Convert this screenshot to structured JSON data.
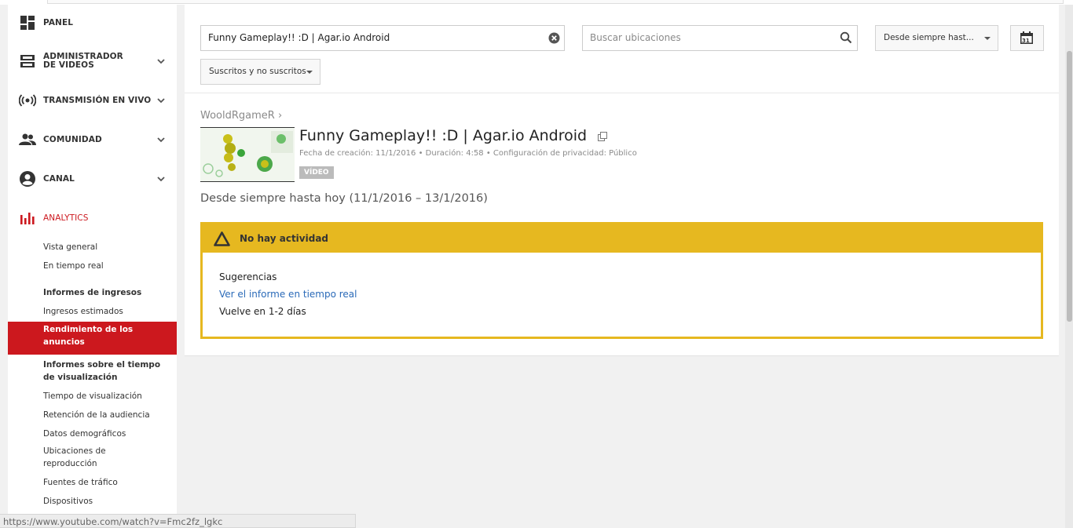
{
  "sidebar": {
    "main": [
      {
        "label": "PANEL"
      },
      {
        "label": "ADMINISTRADOR DE VIDEOS"
      },
      {
        "label": "TRANSMISIÓN EN VIVO"
      },
      {
        "label": "COMUNIDAD"
      },
      {
        "label": "CANAL"
      },
      {
        "label": "ANALYTICS"
      }
    ],
    "analytics_items": [
      "Vista general",
      "En tiempo real",
      "Informes de ingresos",
      "Ingresos estimados",
      "Rendimiento de los anuncios",
      "Informes sobre el tiempo de visualización",
      "Tiempo de visualización",
      "Retención de la audiencia",
      "Datos demográficos",
      "Ubicaciones de reproducción",
      "Fuentes de tráfico",
      "Dispositivos"
    ],
    "accent_color": "#cc181e"
  },
  "filters": {
    "search_value": "Funny Gameplay!! :D | Agar.io Android",
    "location_placeholder": "Buscar ubicaciones",
    "date_label": "Desde siempre hast...",
    "calendar_day": "31",
    "subscribers_label": "Suscritos y no suscritos"
  },
  "video": {
    "channel": "WooldRgameR",
    "channel_sep": "›",
    "title": "Funny Gameplay!! :D | Agar.io Android",
    "meta": "Fecha de creación: 11/1/2016  •  Duración: 4:58  •  Configuración de privacidad: Público",
    "badge": "VÍDEO"
  },
  "range_text": "Desde siempre hasta hoy (11/1/2016 – 13/1/2016)",
  "alert": {
    "title": "No hay actividad",
    "suggestions_title": "Sugerencias",
    "realtime_link": "Ver el informe en tiempo real",
    "return_text": "Vuelve en 1-2 días",
    "color": "#e6b820"
  },
  "status_url": "https://www.youtube.com/watch?v=Fmc2fz_lgkc"
}
